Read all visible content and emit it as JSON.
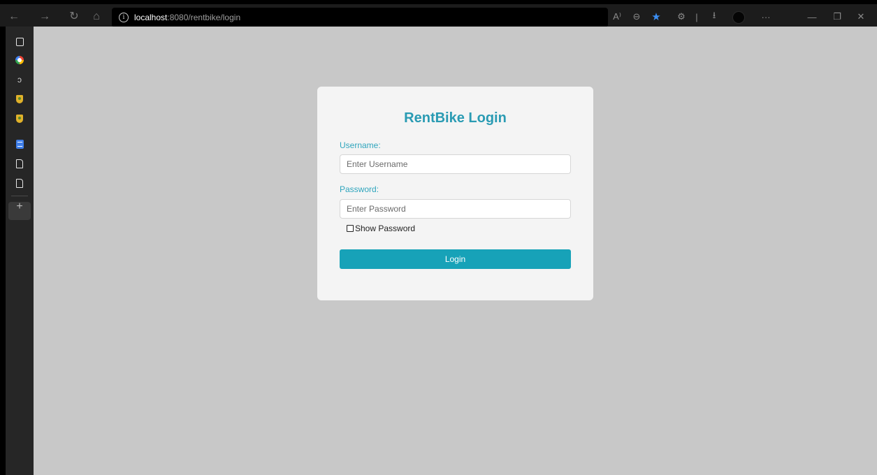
{
  "browser": {
    "address_host": "localhost",
    "address_path": ":8080/rentbike/login",
    "nav_icons": {
      "back": "←",
      "forward": "→",
      "refresh": "↻",
      "home": "⌂"
    },
    "toolbar_icons": {
      "read_aloud": "A⁾",
      "zoom": "⊖",
      "favorite": "★",
      "extensions": "⚙",
      "separator": "|",
      "downloads": "⭳",
      "more": "···",
      "minimize": "—",
      "restore": "❐",
      "close": "✕"
    },
    "accent_color": "#3b8ff5"
  },
  "sidebar": {
    "add_label": "+"
  },
  "login": {
    "title": "RentBike Login",
    "username_label": "Username:",
    "username_placeholder": "Enter Username",
    "password_label": "Password:",
    "password_placeholder": "Enter Password",
    "show_password_label": "Show Password",
    "button_label": "Login",
    "accent_color": "#17a2b8"
  }
}
